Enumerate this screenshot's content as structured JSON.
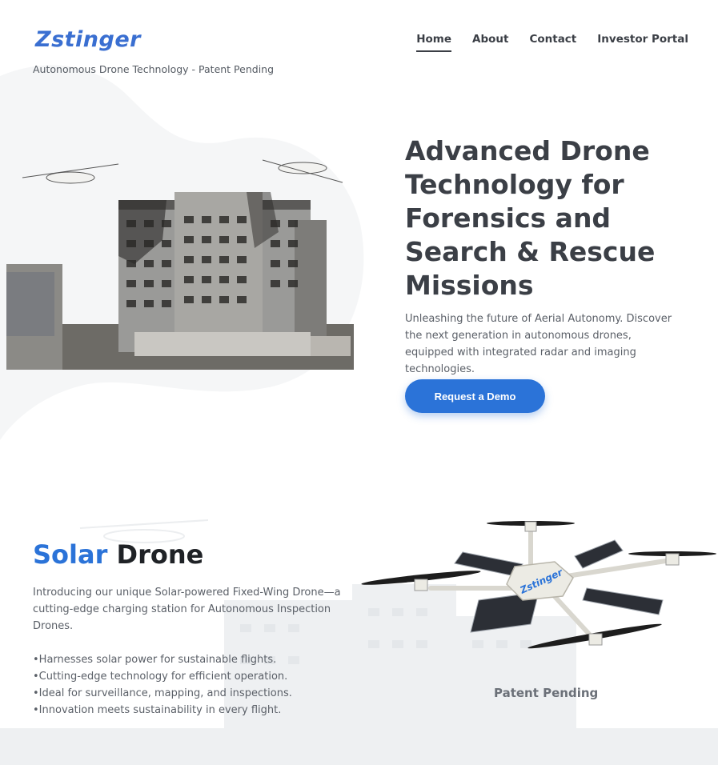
{
  "brand": {
    "logo": "Zstinger",
    "tagline": "Autonomous Drone Technology - Patent Pending"
  },
  "nav": {
    "items": [
      {
        "label": "Home",
        "active": true
      },
      {
        "label": "About",
        "active": false
      },
      {
        "label": "Contact",
        "active": false
      },
      {
        "label": "Investor Portal",
        "active": false
      }
    ]
  },
  "hero": {
    "title": "Advanced Drone Technology for Forensics and Search & Rescue Missions",
    "subtitle": "Unleashing the future of Aerial Autonomy. Discover the next generation in autonomous drones, equipped with integrated radar and imaging technologies.",
    "cta_label": "Request a Demo"
  },
  "solar": {
    "title_word1": "Solar",
    "title_word2": "Drone",
    "intro": "Introducing our unique Solar-powered Fixed-Wing Drone—a cutting-edge charging station for Autonomous Inspection Drones.",
    "bullets": [
      "Harnesses solar power for sustainable flights.",
      "Cutting-edge technology for efficient operation.",
      "Ideal for surveillance, mapping, and inspections.",
      "Innovation meets sustainability in every flight."
    ],
    "patent": "Patent Pending",
    "drone_label": "Zstinger"
  },
  "colors": {
    "accent": "#2b73d8",
    "text": "#3b3f46",
    "blob": "#f5f6f7"
  }
}
